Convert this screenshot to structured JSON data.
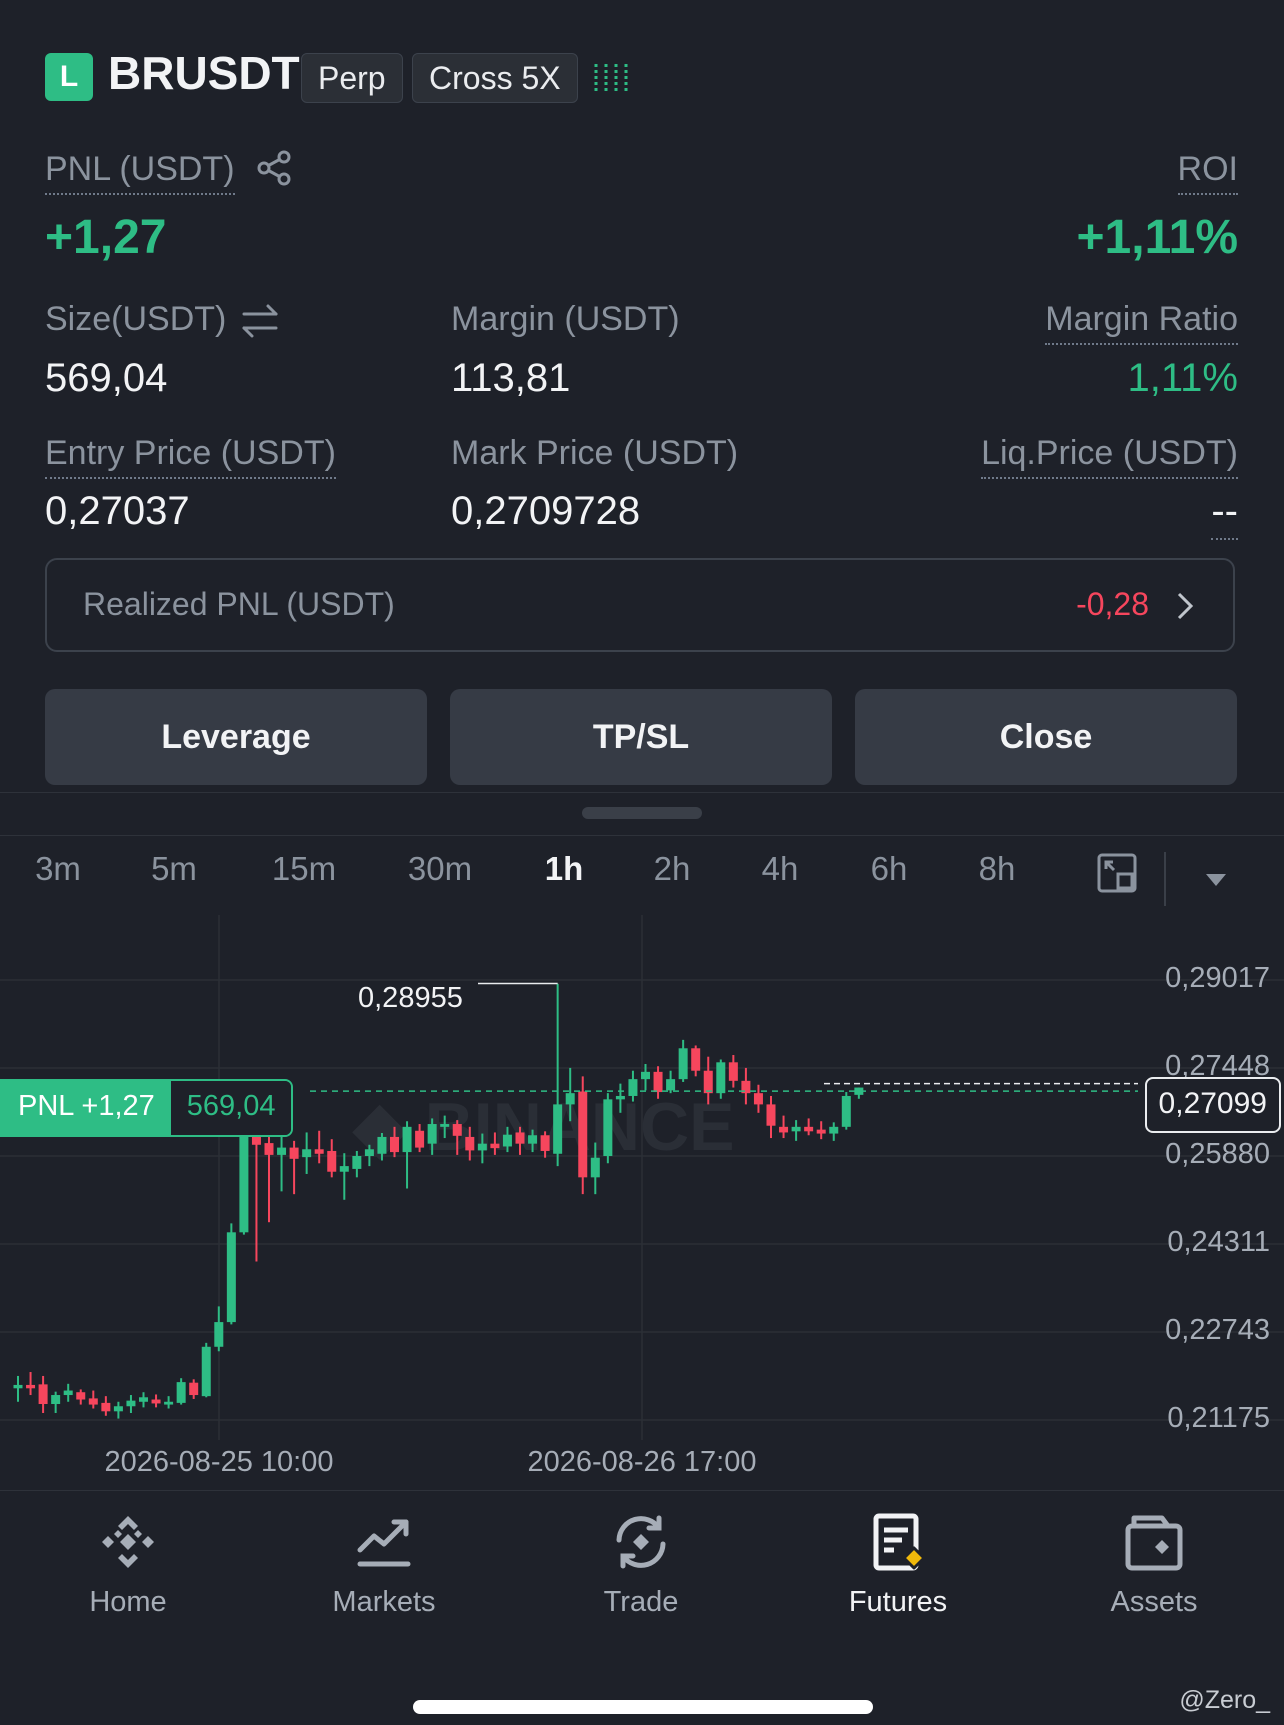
{
  "position": {
    "side_badge": "L",
    "symbol": "BRUSDT",
    "contract_type": "Perp",
    "margin_mode": "Cross 5X",
    "signal_icon": "signal-bars-icon"
  },
  "pnl": {
    "label": "PNL (USDT)",
    "value": "+1,27"
  },
  "roi": {
    "label": "ROI",
    "value": "+1,11%"
  },
  "size": {
    "label": "Size(USDT)",
    "value": "569,04"
  },
  "margin": {
    "label": "Margin (USDT)",
    "value": "113,81"
  },
  "margin_ratio": {
    "label": "Margin Ratio",
    "value": "1,11%"
  },
  "entry_price": {
    "label": "Entry Price (USDT)",
    "value": "0,27037"
  },
  "mark_price": {
    "label": "Mark Price (USDT)",
    "value": "0,2709728"
  },
  "liq_price": {
    "label": "Liq.Price (USDT)",
    "value": "--"
  },
  "realized_pnl": {
    "label": "Realized PNL (USDT)",
    "value": "-0,28"
  },
  "actions": {
    "leverage": "Leverage",
    "tpsl": "TP/SL",
    "close": "Close"
  },
  "timeframes": [
    "3m",
    "5m",
    "15m",
    "30m",
    "1h",
    "2h",
    "4h",
    "6h",
    "8h"
  ],
  "active_timeframe": "1h",
  "chart": {
    "watermark": "BINANCE",
    "high_label": "0,28955",
    "pnl_tag_label": "PNL +1,27",
    "pnl_tag_size": "569,04",
    "current_price": "0,27099",
    "y_ticks": [
      "0,29017",
      "0,27448",
      "0,25880",
      "0,24311",
      "0,22743",
      "0,21175"
    ],
    "x_ticks": [
      "2026-08-25 10:00",
      "2026-08-26 17:00"
    ]
  },
  "chart_data": {
    "type": "candlestick",
    "interval": "1h",
    "y_ticks": [
      0.29017,
      0.27448,
      0.2588,
      0.24311,
      0.22743,
      0.21175
    ],
    "ylim": [
      0.2075,
      0.2965
    ],
    "x_ticks": [
      "2026-08-25 10:00",
      "2026-08-26 17:00"
    ],
    "highest_marked": 0.28955,
    "current_price": 0.27099,
    "entry_price": 0.27037,
    "candles": [
      {
        "o": 0.2174,
        "h": 0.2196,
        "l": 0.215,
        "c": 0.218
      },
      {
        "o": 0.218,
        "h": 0.2203,
        "l": 0.2162,
        "c": 0.2174
      },
      {
        "o": 0.2181,
        "h": 0.2196,
        "l": 0.213,
        "c": 0.2146
      },
      {
        "o": 0.2146,
        "h": 0.2168,
        "l": 0.213,
        "c": 0.2162
      },
      {
        "o": 0.2162,
        "h": 0.2182,
        "l": 0.215,
        "c": 0.217
      },
      {
        "o": 0.2167,
        "h": 0.2172,
        "l": 0.2145,
        "c": 0.2154
      },
      {
        "o": 0.2156,
        "h": 0.217,
        "l": 0.2138,
        "c": 0.2145
      },
      {
        "o": 0.2148,
        "h": 0.216,
        "l": 0.2125,
        "c": 0.2133
      },
      {
        "o": 0.2133,
        "h": 0.215,
        "l": 0.212,
        "c": 0.2142
      },
      {
        "o": 0.2142,
        "h": 0.2162,
        "l": 0.213,
        "c": 0.2152
      },
      {
        "o": 0.215,
        "h": 0.2167,
        "l": 0.214,
        "c": 0.2158
      },
      {
        "o": 0.2154,
        "h": 0.2163,
        "l": 0.214,
        "c": 0.2147
      },
      {
        "o": 0.2145,
        "h": 0.216,
        "l": 0.2138,
        "c": 0.215
      },
      {
        "o": 0.2148,
        "h": 0.2192,
        "l": 0.2145,
        "c": 0.2185
      },
      {
        "o": 0.2184,
        "h": 0.219,
        "l": 0.2155,
        "c": 0.2162
      },
      {
        "o": 0.216,
        "h": 0.2255,
        "l": 0.2158,
        "c": 0.2248
      },
      {
        "o": 0.2248,
        "h": 0.232,
        "l": 0.224,
        "c": 0.2292
      },
      {
        "o": 0.2292,
        "h": 0.2468,
        "l": 0.2288,
        "c": 0.2452
      },
      {
        "o": 0.2452,
        "h": 0.265,
        "l": 0.2448,
        "c": 0.2637
      },
      {
        "o": 0.2637,
        "h": 0.265,
        "l": 0.24,
        "c": 0.2608
      },
      {
        "o": 0.2611,
        "h": 0.2637,
        "l": 0.247,
        "c": 0.259
      },
      {
        "o": 0.259,
        "h": 0.2625,
        "l": 0.2525,
        "c": 0.2603
      },
      {
        "o": 0.2603,
        "h": 0.2615,
        "l": 0.252,
        "c": 0.2583
      },
      {
        "o": 0.2586,
        "h": 0.263,
        "l": 0.2556,
        "c": 0.26
      },
      {
        "o": 0.26,
        "h": 0.2633,
        "l": 0.2575,
        "c": 0.2592
      },
      {
        "o": 0.2597,
        "h": 0.2618,
        "l": 0.255,
        "c": 0.256
      },
      {
        "o": 0.256,
        "h": 0.2593,
        "l": 0.251,
        "c": 0.257
      },
      {
        "o": 0.2565,
        "h": 0.2597,
        "l": 0.255,
        "c": 0.2588
      },
      {
        "o": 0.2588,
        "h": 0.2608,
        "l": 0.257,
        "c": 0.26
      },
      {
        "o": 0.2592,
        "h": 0.2629,
        "l": 0.258,
        "c": 0.2622
      },
      {
        "o": 0.2622,
        "h": 0.264,
        "l": 0.2586,
        "c": 0.2595
      },
      {
        "o": 0.2595,
        "h": 0.265,
        "l": 0.253,
        "c": 0.264
      },
      {
        "o": 0.2633,
        "h": 0.2645,
        "l": 0.2595,
        "c": 0.2603
      },
      {
        "o": 0.261,
        "h": 0.2655,
        "l": 0.259,
        "c": 0.2645
      },
      {
        "o": 0.264,
        "h": 0.266,
        "l": 0.262,
        "c": 0.2645
      },
      {
        "o": 0.2645,
        "h": 0.2652,
        "l": 0.259,
        "c": 0.2624
      },
      {
        "o": 0.2622,
        "h": 0.264,
        "l": 0.258,
        "c": 0.2598
      },
      {
        "o": 0.2598,
        "h": 0.2628,
        "l": 0.2575,
        "c": 0.261
      },
      {
        "o": 0.261,
        "h": 0.263,
        "l": 0.259,
        "c": 0.2602
      },
      {
        "o": 0.2605,
        "h": 0.264,
        "l": 0.2595,
        "c": 0.2626
      },
      {
        "o": 0.263,
        "h": 0.264,
        "l": 0.259,
        "c": 0.261
      },
      {
        "o": 0.261,
        "h": 0.2635,
        "l": 0.2595,
        "c": 0.2625
      },
      {
        "o": 0.2625,
        "h": 0.2632,
        "l": 0.2585,
        "c": 0.2597
      },
      {
        "o": 0.2592,
        "h": 0.2895,
        "l": 0.257,
        "c": 0.268
      },
      {
        "o": 0.268,
        "h": 0.2745,
        "l": 0.265,
        "c": 0.27
      },
      {
        "o": 0.2703,
        "h": 0.273,
        "l": 0.252,
        "c": 0.255
      },
      {
        "o": 0.255,
        "h": 0.2612,
        "l": 0.252,
        "c": 0.2585
      },
      {
        "o": 0.2588,
        "h": 0.27,
        "l": 0.2575,
        "c": 0.2689
      },
      {
        "o": 0.2689,
        "h": 0.2717,
        "l": 0.2665,
        "c": 0.2695
      },
      {
        "o": 0.2695,
        "h": 0.274,
        "l": 0.2685,
        "c": 0.2725
      },
      {
        "o": 0.2725,
        "h": 0.2752,
        "l": 0.2705,
        "c": 0.2738
      },
      {
        "o": 0.2738,
        "h": 0.2748,
        "l": 0.269,
        "c": 0.2702
      },
      {
        "o": 0.2705,
        "h": 0.274,
        "l": 0.27,
        "c": 0.2725
      },
      {
        "o": 0.2725,
        "h": 0.2795,
        "l": 0.272,
        "c": 0.278
      },
      {
        "o": 0.278,
        "h": 0.2785,
        "l": 0.273,
        "c": 0.274
      },
      {
        "o": 0.274,
        "h": 0.2765,
        "l": 0.268,
        "c": 0.27
      },
      {
        "o": 0.27,
        "h": 0.276,
        "l": 0.269,
        "c": 0.2755
      },
      {
        "o": 0.2755,
        "h": 0.2768,
        "l": 0.271,
        "c": 0.2722
      },
      {
        "o": 0.2722,
        "h": 0.2745,
        "l": 0.268,
        "c": 0.27
      },
      {
        "o": 0.27,
        "h": 0.2715,
        "l": 0.2665,
        "c": 0.268
      },
      {
        "o": 0.268,
        "h": 0.2695,
        "l": 0.262,
        "c": 0.2642
      },
      {
        "o": 0.264,
        "h": 0.266,
        "l": 0.262,
        "c": 0.263
      },
      {
        "o": 0.2632,
        "h": 0.2652,
        "l": 0.2615,
        "c": 0.264
      },
      {
        "o": 0.264,
        "h": 0.2655,
        "l": 0.2625,
        "c": 0.2632
      },
      {
        "o": 0.2635,
        "h": 0.265,
        "l": 0.2618,
        "c": 0.2628
      },
      {
        "o": 0.2628,
        "h": 0.2648,
        "l": 0.2615,
        "c": 0.264
      },
      {
        "o": 0.264,
        "h": 0.2702,
        "l": 0.2635,
        "c": 0.2695
      },
      {
        "o": 0.2697,
        "h": 0.271,
        "l": 0.269,
        "c": 0.271
      }
    ]
  },
  "nav": [
    {
      "label": "Home",
      "icon": "binance-logo-icon"
    },
    {
      "label": "Markets",
      "icon": "trend-chart-icon"
    },
    {
      "label": "Trade",
      "icon": "trade-swap-icon"
    },
    {
      "label": "Futures",
      "icon": "futures-document-icon"
    },
    {
      "label": "Assets",
      "icon": "wallet-icon"
    }
  ],
  "active_nav": "Futures",
  "footer_handle": "@Zero_",
  "colors": {
    "background": "#1e2129",
    "up": "#2ebd85",
    "down": "#f6465d",
    "button_bg": "#363b45",
    "text_primary": "#f2f3f5",
    "text_secondary": "#8b939e"
  }
}
